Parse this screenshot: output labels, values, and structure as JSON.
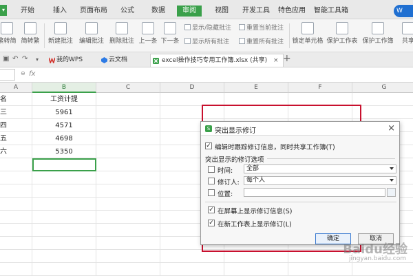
{
  "menu": {
    "app_button": "▾",
    "items": [
      "开始",
      "插入",
      "页面布局",
      "公式",
      "数据",
      "审阅",
      "视图",
      "开发工具",
      "特色应用",
      "智能工具箱"
    ],
    "active": "审阅",
    "account_badge": "W"
  },
  "ribbon": {
    "left_cut_1": "繁转简",
    "left_cut_2": "简转繁",
    "new_comment": "新建批注",
    "edit_comment": "编辑批注",
    "delete_comment": "删除批注",
    "prev": "上一条",
    "next": "下一条",
    "show_hide_comment": "显示/隐藏批注",
    "show_all_comments": "显示所有批注",
    "reset_current": "重置当前批注",
    "reset_all": "重置所有批注",
    "lock_cell": "锁定单元格",
    "protect_sheet": "保护工作表",
    "protect_workbook": "保护工作簿",
    "share": "共享"
  },
  "tabs": {
    "my_wps": "我的WPS",
    "cloud_docs": "云文档",
    "active_file": "excel操作技巧专用工作簿.xlsx (共享)",
    "add": "+"
  },
  "formula_bar": {
    "fx": "fx",
    "value": ""
  },
  "grid": {
    "columns": [
      "A",
      "B",
      "C",
      "D",
      "E",
      "F",
      "G"
    ],
    "selected_column": "B",
    "header_row": [
      "名",
      "工资计提"
    ],
    "rows": [
      {
        "a": "三",
        "b": "5961"
      },
      {
        "a": "四",
        "b": "4571"
      },
      {
        "a": "五",
        "b": "4698"
      },
      {
        "a": "六",
        "b": "5350"
      }
    ]
  },
  "dialog": {
    "title": "突出显示修订",
    "track_changes": "编辑时跟踪修订信息，同时共享工作簿(T)",
    "section_label": "突出显示的修订选项",
    "time_label": "时间:",
    "time_value": "全部",
    "reviser_label": "修订人:",
    "reviser_value": "每个人",
    "location_label": "位置:",
    "location_value": "",
    "show_on_screen": "在屏幕上显示修订信息(S)",
    "list_on_new_sheet": "在新工作表上显示修订(L)",
    "ok": "确定",
    "cancel": "取消",
    "track_checked": true,
    "time_checked": false,
    "reviser_checked": false,
    "location_checked": false,
    "show_screen_checked": true,
    "list_new_checked": true
  },
  "watermark": {
    "main": "Baidu经验",
    "sub": "jingyan.baidu.com"
  },
  "colors": {
    "accent": "#3aa04a",
    "highlight": "#c8102e",
    "wps_blue": "#1f6fd1"
  }
}
